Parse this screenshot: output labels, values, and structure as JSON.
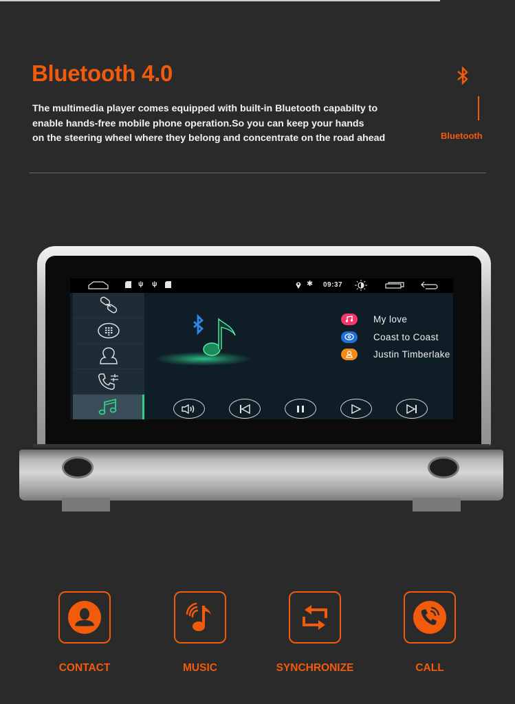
{
  "header": {
    "title": "Bluetooth 4.0",
    "description": "The multimedia player comes equipped with built-in Bluetooth capabilty to\nenable hands-free mobile phone operation.So you can keep your hands\non the steering wheel where they belong and concentrate on the road ahead",
    "side_icon": "bluetooth-icon",
    "side_label": "Bluetooth"
  },
  "colors": {
    "accent": "#f25a0c",
    "background": "#2a2a2a",
    "screen_bg": "#0f1d27",
    "active_green": "#2fd08c"
  },
  "screen": {
    "statusbar": {
      "left_icons": [
        "home-icon",
        "sd-card-icon",
        "usb-icon",
        "usb-icon",
        "sd-card-icon"
      ],
      "right_icons": [
        "location-icon",
        "bluetooth-icon"
      ],
      "time": "09:37",
      "buttons": [
        "brightness-icon",
        "recent-apps-icon",
        "back-icon"
      ]
    },
    "sidebar": {
      "items": [
        {
          "icon": "link-icon",
          "active": false
        },
        {
          "icon": "dialpad-icon",
          "active": false
        },
        {
          "icon": "contacts-icon",
          "active": false
        },
        {
          "icon": "call-settings-icon",
          "active": false
        },
        {
          "icon": "music-icon",
          "active": true
        }
      ]
    },
    "now_playing": {
      "art_icon": "bluetooth-music-note-icon",
      "tracks": [
        {
          "icon": "music-icon",
          "color": "#f0386b",
          "text": "My love"
        },
        {
          "icon": "disc-icon",
          "color": "#1f6fd6",
          "text": "Coast to Coast"
        },
        {
          "icon": "artist-icon",
          "color": "#f58a16",
          "text": "Justin Timberlake"
        }
      ]
    },
    "controls": [
      "volume-icon",
      "previous-icon",
      "pause-icon",
      "play-icon",
      "next-icon"
    ]
  },
  "features": [
    {
      "icon": "contact-icon",
      "label": "CONTACT"
    },
    {
      "icon": "music-icon",
      "label": "MUSIC"
    },
    {
      "icon": "synchronize-icon",
      "label": "SYNCHRONIZE"
    },
    {
      "icon": "call-icon",
      "label": "CALL"
    }
  ]
}
